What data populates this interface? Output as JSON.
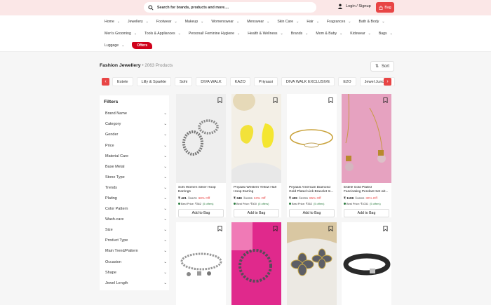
{
  "header": {
    "search_placeholder": "Search for brands, products and more....",
    "login_label": "Login / Signup",
    "bag_label": "Bag"
  },
  "nav": {
    "row1": [
      "Home",
      "Jewellery",
      "Footwear",
      "Makeup",
      "Womenswear",
      "Menswear",
      "Skin Care",
      "Hair",
      "Fragrances",
      "Bath & Body"
    ],
    "row2": [
      "Men's Grooming",
      "Tools & Appliances",
      "Personal/ Feminine Hygiene",
      "Health & Wellness",
      "Brands",
      "Mom & Baby",
      "Kidswear",
      "Bags"
    ],
    "row3": [
      "Luggage"
    ],
    "offers_label": "Offers"
  },
  "page": {
    "title": "Fashion Jewellery",
    "count": "• 2063 Products",
    "sort_label": "Sort"
  },
  "brands": [
    "Estele",
    "Lilly & Sparkle",
    "Sohi",
    "DIVA WALK",
    "KAZO",
    "Priyaasi",
    "DIVA WALK EXCLUSIVE",
    "E2O",
    "Jewel Junction"
  ],
  "filters": {
    "title": "Filters",
    "items": [
      "Brand Name",
      "Category",
      "Gender",
      "Price",
      "Material Care",
      "Base Metal",
      "Stone Type",
      "Trends",
      "Plating",
      "Color Pattern",
      "Wash-care",
      "Size",
      "Product Type",
      "Main Trend/Pattern",
      "Occasion",
      "Shape",
      "Jewel Length"
    ]
  },
  "products": [
    {
      "name": "Sohi Women Silver Hoop Earrings",
      "price": "₹ 421",
      "mrp": "₹1179",
      "off": "68% Off",
      "best": "Best Price: ₹362",
      "offers": "(5 offers)",
      "add_label": "Add to Bag"
    },
    {
      "name": "Priyaasi Western Yellow Half Hoop Earring",
      "price": "₹ 349",
      "mrp": "₹1095",
      "off": "63% Off",
      "best": "Best Price: ₹300",
      "offers": "(5 offers)",
      "add_label": "Add to Bag"
    },
    {
      "name": "Priyaasi American Diamond Gold Plated Link Bracelet In...",
      "price": "₹ 409",
      "mrp": "₹2795",
      "off": "85% Off",
      "best": "Best Price: ₹352",
      "offers": "(5 offers)",
      "add_label": "Add to Bag"
    },
    {
      "name": "Estele Gold Plated Fascinating Pendant Set wit...",
      "price": "₹ 1199",
      "mrp": "₹1699",
      "off": "30% Off",
      "best": "Best Price: ₹1031",
      "offers": "(5 offers)",
      "add_label": "Add to Bag"
    }
  ],
  "colors": {
    "accent": "#e84545",
    "topbar_bg": "#fbe7e7",
    "offers_bg": "#d0021b",
    "best_price_green": "#2a7c3e"
  }
}
